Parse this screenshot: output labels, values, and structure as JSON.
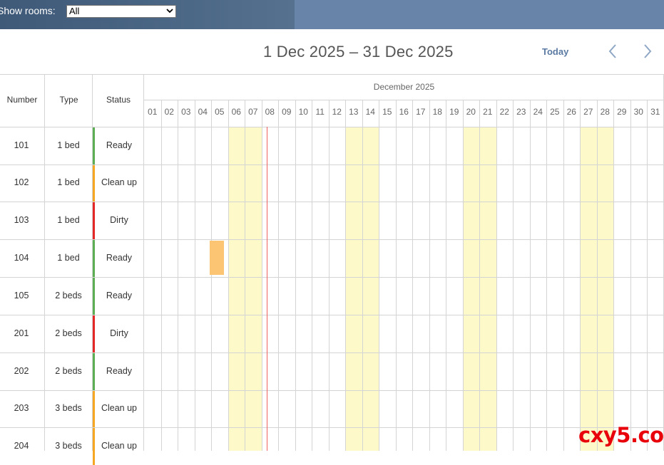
{
  "filter": {
    "label": "Show rooms:",
    "selected": "All"
  },
  "header": {
    "date_range": "1 Dec 2025 – 31 Dec 2025",
    "today_label": "Today"
  },
  "columns": {
    "number": "Number",
    "type": "Type",
    "status": "Status"
  },
  "calendar": {
    "month": "December 2025",
    "days": [
      "01",
      "02",
      "03",
      "04",
      "05",
      "06",
      "07",
      "08",
      "09",
      "10",
      "11",
      "12",
      "13",
      "14",
      "15",
      "16",
      "17",
      "18",
      "19",
      "20",
      "21",
      "22",
      "23",
      "24",
      "25",
      "26",
      "27",
      "28",
      "29",
      "30",
      "31"
    ],
    "weekend_days": [
      "06",
      "07",
      "13",
      "14",
      "20",
      "21",
      "27",
      "28"
    ],
    "today": "08"
  },
  "status_colors": {
    "Ready": "#5cad54",
    "Clean up": "#f5a623",
    "Dirty": "#e32626"
  },
  "rooms": [
    {
      "number": "101",
      "type": "1 bed",
      "status": "Ready"
    },
    {
      "number": "102",
      "type": "1 bed",
      "status": "Clean up"
    },
    {
      "number": "103",
      "type": "1 bed",
      "status": "Dirty"
    },
    {
      "number": "104",
      "type": "1 bed",
      "status": "Ready"
    },
    {
      "number": "105",
      "type": "2 beds",
      "status": "Ready"
    },
    {
      "number": "201",
      "type": "2 beds",
      "status": "Dirty"
    },
    {
      "number": "202",
      "type": "2 beds",
      "status": "Ready"
    },
    {
      "number": "203",
      "type": "3 beds",
      "status": "Clean up"
    },
    {
      "number": "204",
      "type": "3 beds",
      "status": "Clean up"
    }
  ],
  "bookings": [
    {
      "room": "104",
      "start_day": "05",
      "end_day": "05",
      "color": "#fcc574"
    }
  ],
  "watermark": "cxy5.com"
}
